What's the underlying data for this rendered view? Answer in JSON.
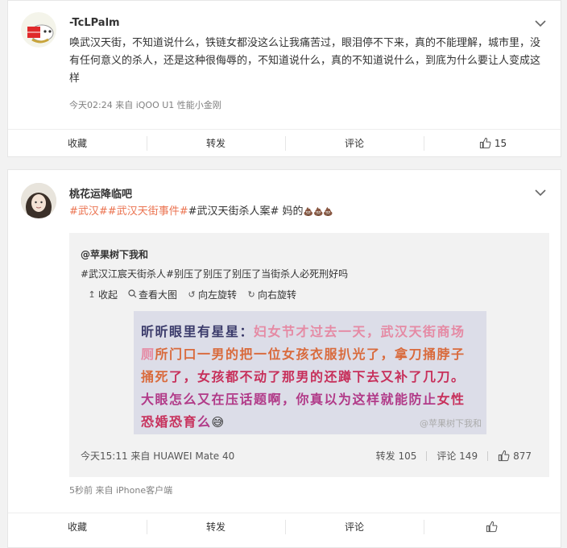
{
  "post1": {
    "username": "-TcLPalm",
    "text": "唤武汉天街，不知道说什么，铁链女都没这么让我痛苦过，眼泪停不下来，真的不能理解，城市里，没有任何意义的杀人，还是这种很侮辱的，不知道说什么，真的不知道说什么，到底为什么要让人变成这样",
    "meta": "今天02:24  来自 iQOO U1 性能小金刚",
    "actions": {
      "favorite": "收藏",
      "repost": "转发",
      "comment": "评论",
      "like_count": "15"
    }
  },
  "post2": {
    "username": "桃花运降临吧",
    "tags": [
      "#武汉#",
      "#武汉天街事件#"
    ],
    "tag_plain": "#武汉天街杀人案#",
    "text_tail": " 妈的",
    "emoji": "💩💩💩",
    "repost": {
      "user": "@苹果树下我和",
      "text": "#武汉江宸天街杀人#别压了别压了别压了当街杀人必死刑好吗",
      "tools": [
        {
          "icon": "collapse-icon",
          "glyph": "↥",
          "label": "收起"
        },
        {
          "icon": "magnifier-icon",
          "glyph": "🔍",
          "label": "查看大图"
        },
        {
          "icon": "rotate-left-icon",
          "glyph": "↺",
          "label": "向左旋转"
        },
        {
          "icon": "rotate-right-icon",
          "glyph": "↻",
          "label": "向右旋转"
        }
      ],
      "image": {
        "name": "昕昕眼里有星星",
        "colon": "：",
        "seg1": "妇女节才过去一天，武汉天街商场厕",
        "seg2": "所门口一男的把一位女孩衣服扒光了，拿刀捅脖子捅死",
        "seg3": "了，女孩都不动了那男的还蹲下去又补了几刀。",
        "seg4": "大眼怎么又在压话题啊，你真以为这样就能防止",
        "seg5": "女性恐婚恐育",
        "seg6": "么",
        "emoji": "😅",
        "watermark": "@苹果树下我和"
      },
      "meta": "今天15:11  来自 HUAWEI Mate 40",
      "repost_label": "转发 105",
      "comment_label": "评论 149",
      "like_count": "877"
    },
    "meta": "5秒前  来自 iPhone客户端",
    "actions": {
      "favorite": "收藏",
      "repost": "转发",
      "comment": "评论"
    }
  },
  "colors": {
    "tag": "#eb7350",
    "muted": "#808080",
    "bg": "#f2f2f2"
  }
}
